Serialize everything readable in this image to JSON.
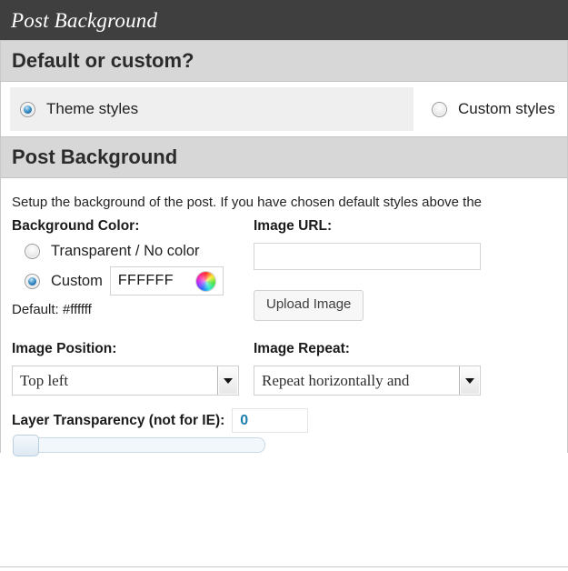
{
  "window": {
    "title": "Post Background"
  },
  "sections": {
    "default_or_custom": {
      "heading": "Default or custom?",
      "options": [
        {
          "label": "Theme styles",
          "selected": true
        },
        {
          "label": "Custom styles",
          "selected": false
        }
      ]
    },
    "post_background": {
      "heading": "Post Background",
      "description": "Setup the background of the post. If you have chosen default styles above the",
      "background_color": {
        "label": "Background Color:",
        "options": [
          {
            "label": "Transparent / No color",
            "selected": false
          },
          {
            "label": "Custom",
            "selected": true
          }
        ],
        "custom_value": "FFFFFF",
        "color_wheel_icon": "color-wheel-icon",
        "default_note": "Default: #ffffff",
        "default_hex": "#ffffff"
      },
      "image_url": {
        "label": "Image URL:",
        "value": "",
        "placeholder": ""
      },
      "upload_button": "Upload Image",
      "image_position": {
        "label": "Image Position:",
        "selected": "Top left"
      },
      "image_repeat": {
        "label": "Image Repeat:",
        "selected": "Repeat horizontally and"
      },
      "layer_transparency": {
        "label": "Layer Transparency (not for IE):",
        "value": "0",
        "slider_position_percent": 0
      }
    }
  },
  "colors": {
    "titlebar_bg": "#3f3f3f",
    "section_head_bg": "#d7d7d7",
    "highlight_row_bg": "#efefef",
    "radio_selected": "#1669a8",
    "value_accent": "#1b7fad"
  }
}
